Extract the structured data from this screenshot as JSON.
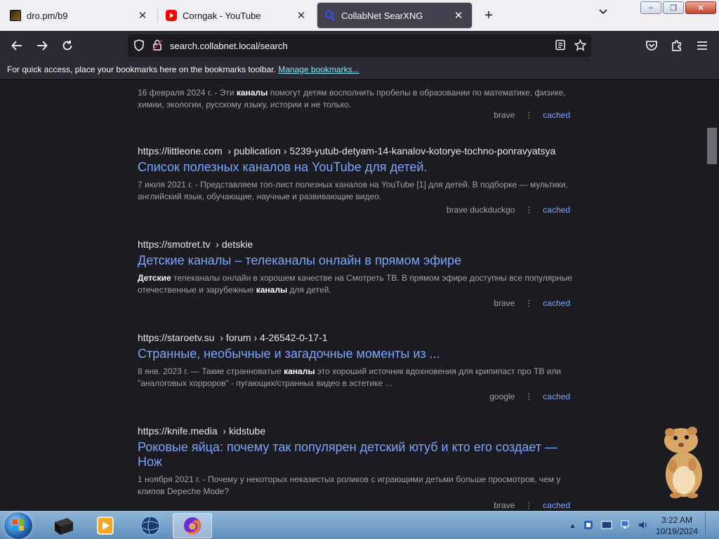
{
  "tabs": [
    {
      "title": "dro.pm/b9",
      "favicon": "game-favicon"
    },
    {
      "title": "Corngak - YouTube",
      "favicon": "youtube-favicon"
    },
    {
      "title": "CollabNet SearXNG",
      "favicon": "searxng-favicon",
      "active": true
    }
  ],
  "window_controls": {
    "minimize": "–",
    "maximize": "❐",
    "close": "✕"
  },
  "nav": {
    "url": "search.collabnet.local/search"
  },
  "bookmarks_bar": {
    "message": "For quick access, place your bookmarks here on the bookmarks toolbar.",
    "link": "Manage bookmarks..."
  },
  "results": [
    {
      "snippet_html": "16 февраля 2024 г. - Эти <b>каналы</b> помогут детям восполнить пробелы в образовании по математике, физике, химии, экологии, русскому языку, истории и не только.",
      "engines": "brave",
      "cached": "cached"
    },
    {
      "url_domain": "https://littleone.com",
      "url_path": "› publication › 5239-yutub-detyam-14-kanalov-kotorye-tochno-ponravyatsya",
      "title": "Список полезных каналов на YouTube для детей.",
      "snippet_html": "7 июля 2021 г. - Представляем топ-лист полезных каналов на YouTube [1] для детей. В подборке — мультики, английский язык, обучающие, научные и развивающие видео.",
      "engines": "brave  duckduckgo",
      "cached": "cached"
    },
    {
      "url_domain": "https://smotret.tv",
      "url_path": "› detskie",
      "title": "Детские каналы – телеканалы онлайн в прямом эфире",
      "snippet_html": "<b>Детские</b> телеканалы онлайн в хорошем качестве на Смотреть ТВ. В прямом эфире доступны все популярные отечественные и зарубежные <b>каналы</b> для детей.",
      "engines": "brave",
      "cached": "cached"
    },
    {
      "url_domain": "https://staroetv.su",
      "url_path": "› forum › 4-26542-0-17-1",
      "title": "Странные, необычные и загадочные моменты из ...",
      "snippet_html": "8 янв. 2023 г. — Такие странноватые <b>каналы</b> это хороший источник вдохновения для крипипаст про ТВ или \"аналоговых хорроров\" - пугающих/странных видео в эстетике ...",
      "engines": "google",
      "cached": "cached"
    },
    {
      "url_domain": "https://knife.media",
      "url_path": "› kidstube",
      "title": "Роковые яйца: почему так популярен детский ютуб и кто его создает — Нож",
      "snippet_html": "1 ноября 2021 г. - Почему у некоторых неказистых роликов с играющими детьми больше просмотров, чем у клипов Depeche Mode?",
      "engines": "brave",
      "cached": "cached"
    }
  ],
  "taskbar": {
    "time": "3:22 AM",
    "date": "10/19/2024"
  }
}
